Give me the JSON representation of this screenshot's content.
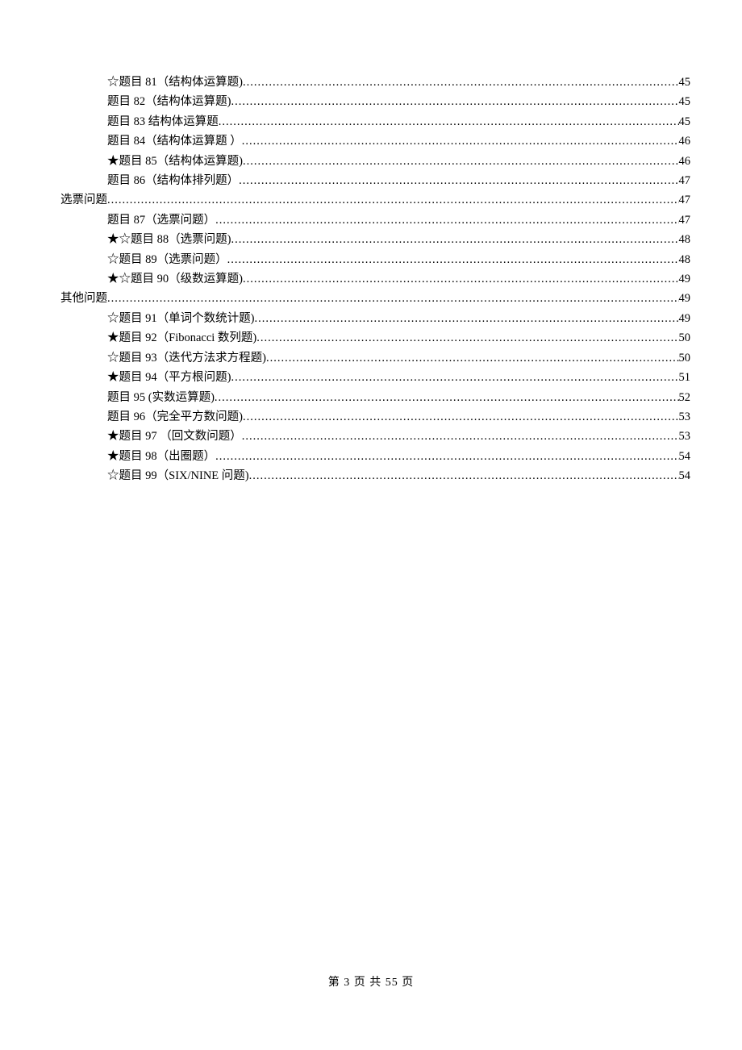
{
  "toc": [
    {
      "level": 2,
      "label": "☆题目 81（结构体运算题)",
      "page": "45"
    },
    {
      "level": 2,
      "label": "题目 82（结构体运算题)",
      "page": "45"
    },
    {
      "level": 2,
      "label": "题目 83  结构体运算题",
      "page": "45"
    },
    {
      "level": 2,
      "label": "题目 84（结构体运算题  ）",
      "page": "46"
    },
    {
      "level": 2,
      "label": "★题目 85（结构体运算题)",
      "page": "46"
    },
    {
      "level": 2,
      "label": "题目 86（结构体排列题）",
      "page": "47"
    },
    {
      "level": 1,
      "label": "选票问题",
      "page": "47"
    },
    {
      "level": 2,
      "label": "题目 87（选票问题）",
      "page": "47"
    },
    {
      "level": 2,
      "label": "★☆题目 88（选票问题)",
      "page": "48"
    },
    {
      "level": 2,
      "label": "☆题目 89（选票问题）",
      "page": "48"
    },
    {
      "level": 2,
      "label": "★☆题目 90（级数运算题)",
      "page": "49"
    },
    {
      "level": 1,
      "label": "其他问题",
      "page": "49"
    },
    {
      "level": 2,
      "label": "☆题目 91（单词个数统计题)",
      "page": "49"
    },
    {
      "level": 2,
      "label": "★题目 92（Fibonacci 数列题)",
      "page": "50"
    },
    {
      "level": 2,
      "label": "☆题目 93（迭代方法求方程题)",
      "page": "50"
    },
    {
      "level": 2,
      "label": "★题目 94（平方根问题)",
      "page": "51"
    },
    {
      "level": 2,
      "label": "题目 95 (实数运算题)",
      "page": "52"
    },
    {
      "level": 2,
      "label": "题目 96（完全平方数问题)",
      "page": "53"
    },
    {
      "level": 2,
      "label": "★题目 97  （回文数问题）",
      "page": "53"
    },
    {
      "level": 2,
      "label": "★题目 98（出圈题）",
      "page": "54"
    },
    {
      "level": 2,
      "label": "☆题目 99（SIX/NINE 问题)",
      "page": "54"
    }
  ],
  "footer": "第 3 页 共 55 页"
}
